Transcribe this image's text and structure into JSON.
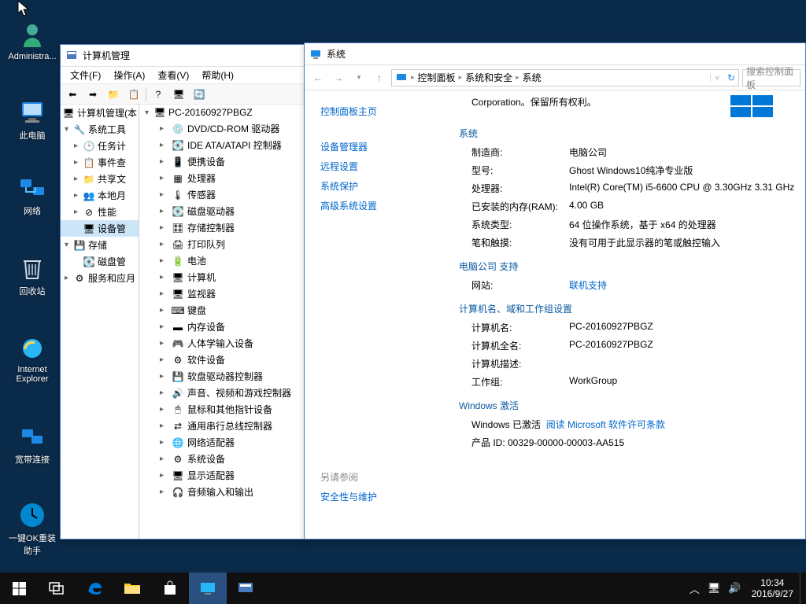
{
  "desktop": {
    "icons": [
      {
        "id": "admin",
        "label": "Administra..."
      },
      {
        "id": "thispc",
        "label": "此电脑"
      },
      {
        "id": "network",
        "label": "网络"
      },
      {
        "id": "recycle",
        "label": "回收站"
      },
      {
        "id": "ie",
        "label": "Internet Explorer"
      },
      {
        "id": "bb",
        "label": "宽带连接"
      },
      {
        "id": "onekeyrecovery",
        "label": "一键OK重装助手"
      }
    ]
  },
  "cm": {
    "title": "计算机管理",
    "menu": [
      "文件(F)",
      "操作(A)",
      "查看(V)",
      "帮助(H)"
    ],
    "left": {
      "root": "计算机管理(本",
      "systools": "系统工具",
      "systools_children": [
        "任务计",
        "事件查",
        "共享文",
        "本地月",
        "性能",
        "设备管"
      ],
      "storage": "存储",
      "storage_children": [
        "磁盘管"
      ],
      "services": "服务和应月"
    },
    "right": {
      "root": "PC-20160927PBGZ",
      "devices": [
        "DVD/CD-ROM 驱动器",
        "IDE ATA/ATAPI 控制器",
        "便携设备",
        "处理器",
        "传感器",
        "磁盘驱动器",
        "存储控制器",
        "打印队列",
        "电池",
        "计算机",
        "监视器",
        "键盘",
        "内存设备",
        "人体学输入设备",
        "软件设备",
        "软盘驱动器控制器",
        "声音、视频和游戏控制器",
        "鼠标和其他指针设备",
        "通用串行总线控制器",
        "网络适配器",
        "系统设备",
        "显示适配器",
        "音频输入和输出"
      ]
    }
  },
  "sys": {
    "title": "系统",
    "breadcrumb": [
      "控制面板",
      "系统和安全",
      "系统"
    ],
    "search_placeholder": "搜索控制面板",
    "side": {
      "home": "控制面板主页",
      "links": [
        "设备管理器",
        "远程设置",
        "系统保护",
        "高级系统设置"
      ],
      "see_also": "另请参阅",
      "sec": "安全性与维护"
    },
    "top_corp": "Corporation。保留所有权利。",
    "basic_h": "系统",
    "kv_basic": [
      {
        "k": "制造商:",
        "v": "电脑公司"
      },
      {
        "k": "型号:",
        "v": "Ghost Windows10纯净专业版"
      },
      {
        "k": "处理器:",
        "v": "Intel(R) Core(TM) i5-6600 CPU @ 3.30GHz 3.31 GHz"
      },
      {
        "k": "已安装的内存(RAM):",
        "v": "4.00 GB"
      },
      {
        "k": "系统类型:",
        "v": "64 位操作系统，基于 x64 的处理器"
      },
      {
        "k": "笔和触摸:",
        "v": "没有可用于此显示器的笔或触控输入"
      }
    ],
    "support_h": "电脑公司 支持",
    "kv_support": [
      {
        "k": "网站:",
        "v": "联机支持"
      }
    ],
    "name_h": "计算机名、域和工作组设置",
    "kv_name": [
      {
        "k": "计算机名:",
        "v": "PC-20160927PBGZ"
      },
      {
        "k": "计算机全名:",
        "v": "PC-20160927PBGZ"
      },
      {
        "k": "计算机描述:",
        "v": ""
      },
      {
        "k": "工作组:",
        "v": "WorkGroup"
      }
    ],
    "act_h": "Windows 激活",
    "act_status": "Windows 已激活",
    "act_link": "阅读 Microsoft 软件许可条款",
    "act_pid": "产品 ID: 00329-00000-00003-AA515"
  },
  "taskbar": {
    "time": "10:34",
    "date": "2016/9/27"
  }
}
